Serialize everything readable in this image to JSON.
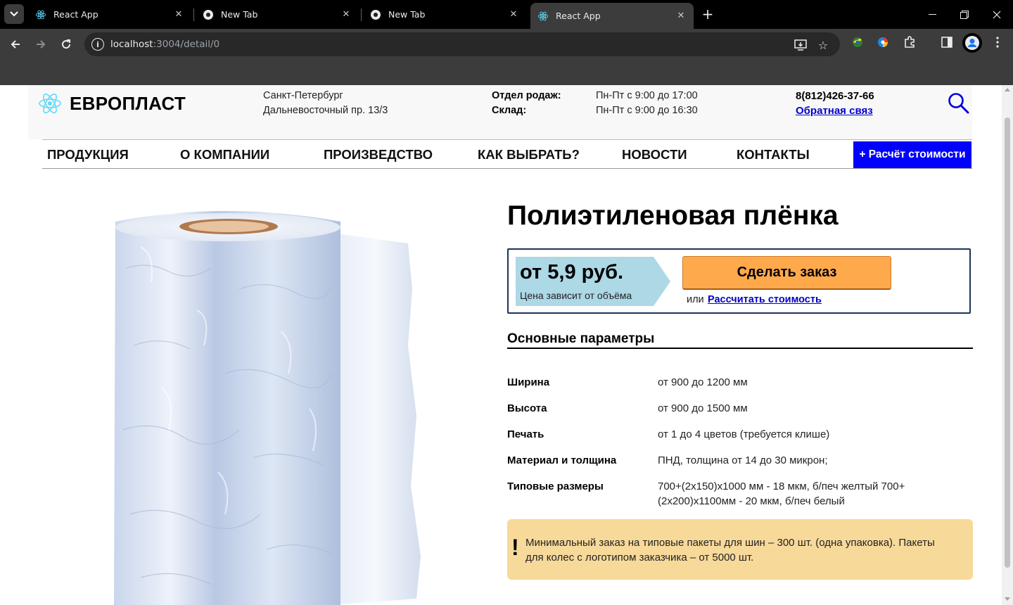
{
  "browser": {
    "tabs": [
      {
        "title": "React App",
        "icon": "react-icon",
        "active": false
      },
      {
        "title": "New Tab",
        "icon": "chrome-icon",
        "active": false
      },
      {
        "title": "New Tab",
        "icon": "chrome-icon",
        "active": false
      },
      {
        "title": "React App",
        "icon": "react-icon",
        "active": true
      }
    ],
    "url_host": "localhost",
    "url_path": ":3004/detail/0"
  },
  "header": {
    "brand": "ЕВРОПЛАСТ",
    "city": "Санкт-Петербург",
    "address": "Дальневосточный пр. 13/3",
    "sales_label": "Отдел родаж:",
    "sales_hours": "Пн-Пт с 9:00 до 17:00",
    "warehouse_label": "Склад:",
    "warehouse_hours": "Пн-Пт с 9:00 до 16:30",
    "phone": "8(812)426-37-66",
    "feedback": "Обратная связ"
  },
  "nav": {
    "items": [
      "ПРОДУКЦИЯ",
      "О КОМПАНИИ",
      "ПРОИЗВЕДСТВО",
      "КАК ВЫБРАТЬ?",
      "НОВОСТИ",
      "КОНТАКТЫ"
    ],
    "calc_button": "+ Расчёт стоимости"
  },
  "product": {
    "title": "Полиэтиленовая плёнка",
    "price": "от 5,9 руб.",
    "price_note": "Цена зависит от объёма",
    "order_button": "Сделать заказ",
    "or_text": "или",
    "calc_link": "Рассчитать стоимость",
    "params_title": "Основные параметры",
    "params": [
      {
        "label": "Ширина",
        "value": "от 900 до 1200 мм"
      },
      {
        "label": "Высота",
        "value": "от 900 до 1500 мм"
      },
      {
        "label": "Печать",
        "value": "от 1 до 4 цветов (требуется клише)"
      },
      {
        "label": "Материал и толщина",
        "value": "ПНД, толщина от 14 до 30 микрон;"
      },
      {
        "label": "Типовые размеры",
        "value": "700+(2x150)x1000 мм - 18 мкм, б/печ желтый 700+(2x200)x1100мм - 20 мкм, б/печ белый"
      }
    ],
    "notice_mark": "!",
    "notice": "Минимальный заказ на типовые пакеты для шин – 300 шт. (одна упаковка). Пакеты для колес с логотипом заказчика – от 5000 шт."
  },
  "colors": {
    "nav_button": "#0000ff",
    "order_button": "#ffa94d",
    "price_tag": "#add8e6",
    "notice_bg": "#f7d99a",
    "price_border": "#1c3459",
    "link": "#0000cc"
  }
}
